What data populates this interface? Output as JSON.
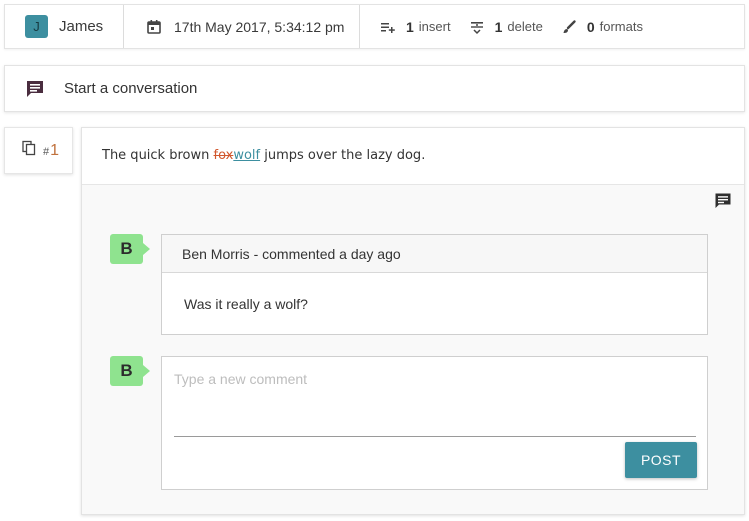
{
  "header": {
    "user_initial": "J",
    "user_name": "James",
    "date": "17th May 2017, 5:34:12 pm",
    "insert_count": "1",
    "insert_label": "insert",
    "delete_count": "1",
    "delete_label": "delete",
    "formats_count": "0",
    "formats_label": "formats"
  },
  "conversation": {
    "label": "Start a conversation"
  },
  "change": {
    "hash": "#",
    "number": "1",
    "sentence_before": "The quick brown ",
    "deleted": "fox",
    "inserted": "wolf",
    "sentence_after": " jumps over the lazy dog."
  },
  "comments": [
    {
      "avatar": "B",
      "header": "Ben Morris - commented a day ago",
      "body": "Was it really a wolf?"
    }
  ],
  "new_comment": {
    "avatar": "B",
    "placeholder": "Type a new comment",
    "post_label": "POST"
  },
  "colors": {
    "accent": "#3d8fa0",
    "delete": "#d1572d",
    "avatar_green": "#8fe38f"
  },
  "icons": {
    "date": "calendar-icon",
    "insert": "playlist-add-icon",
    "delete": "strikethrough-icon",
    "formats": "brush-icon",
    "conversation": "chat-bubble-icon",
    "index": "copy-icon",
    "add_comment": "comment-icon"
  }
}
